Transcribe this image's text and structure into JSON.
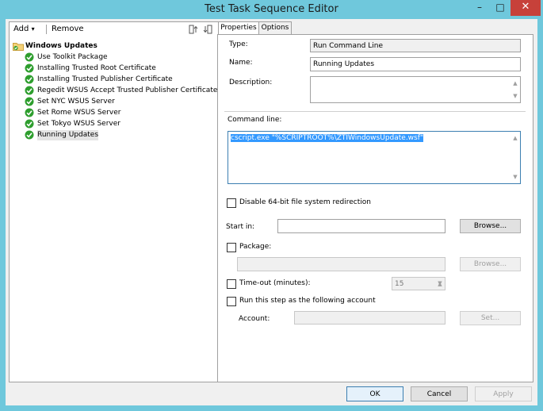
{
  "window": {
    "title": "Test Task Sequence Editor",
    "minimize_glyph": "–",
    "maximize_glyph": "□",
    "close_glyph": "✕"
  },
  "toolbar": {
    "add_label": "Add",
    "add_arrow": "▾",
    "remove_label": "Remove",
    "icons": [
      "move-up-icon",
      "move-down-icon"
    ]
  },
  "tree": {
    "root": "Windows Updates",
    "items": [
      "Use Toolkit Package",
      "Installing Trusted Root Certificate",
      "Installing Trusted Publisher Certificate",
      "Regedit WSUS Accept Trusted Publisher Certificate",
      "Set NYC WSUS Server",
      "Set Rome WSUS Server",
      "Set Tokyo WSUS Server",
      "Running Updates"
    ],
    "selected": "Running Updates"
  },
  "tabs": {
    "properties": "Properties",
    "options": "Options"
  },
  "form": {
    "type_label": "Type:",
    "type_value": "Run Command Line",
    "name_label": "Name:",
    "name_value": "Running Updates",
    "description_label": "Description:",
    "description_value": "",
    "command_label": "Command line:",
    "command_value": "cscript.exe \"%SCRIPTROOT%\\ZTIWindowsUpdate.wsf\"",
    "disable64_label": "Disable 64-bit file system redirection",
    "start_in_label": "Start in:",
    "start_in_value": "",
    "browse_label": "Browse...",
    "package_label": "Package:",
    "package_value": "",
    "package_browse_label": "Browse...",
    "timeout_label": "Time-out (minutes):",
    "timeout_value": "15",
    "run_as_label": "Run this step as the following account",
    "account_label": "Account:",
    "account_value": "",
    "set_label": "Set..."
  },
  "buttons": {
    "ok": "OK",
    "cancel": "Cancel",
    "apply": "Apply"
  },
  "colors": {
    "titlebar": "#6fc8dc",
    "close": "#c7413a",
    "selection": "#3399ff",
    "check_green": "#2e9e2e"
  }
}
